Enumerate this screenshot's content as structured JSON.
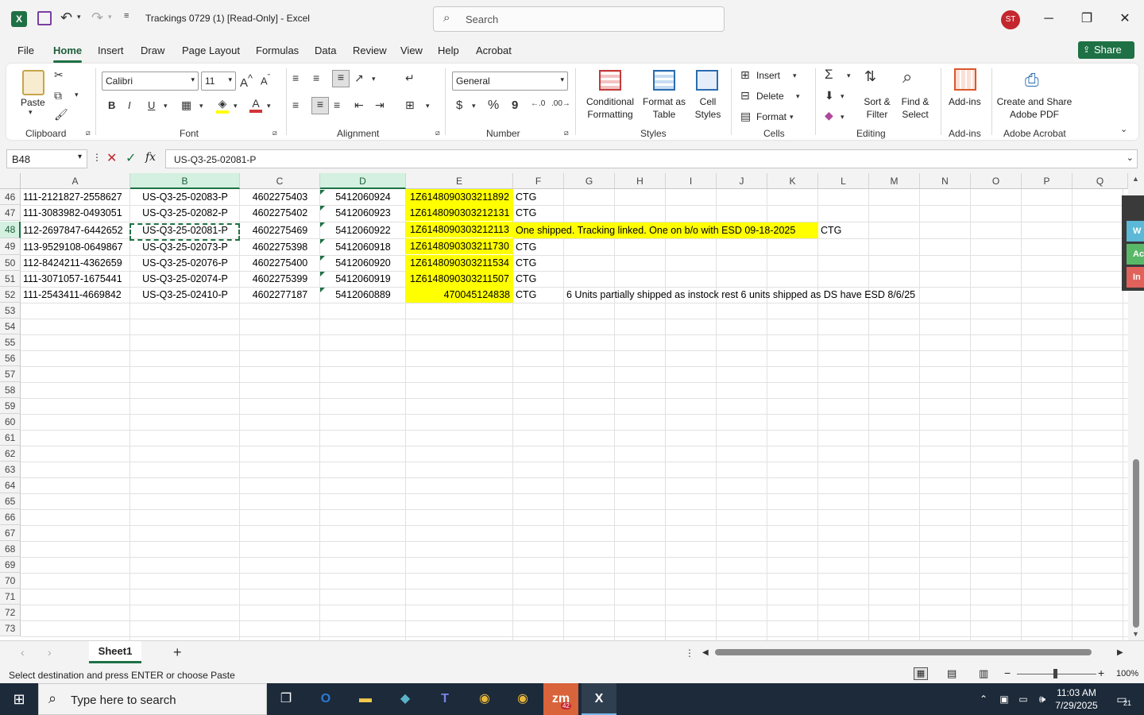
{
  "window": {
    "title": "Trackings 0729 (1)  [Read-Only]  -  Excel",
    "search_placeholder": "Search",
    "user_initials": "ST"
  },
  "menu": {
    "tabs": [
      "File",
      "Home",
      "Insert",
      "Draw",
      "Page Layout",
      "Formulas",
      "Data",
      "Review",
      "View",
      "Help",
      "Acrobat"
    ],
    "active": "Home",
    "share_label": "Share"
  },
  "ribbon": {
    "clipboard": {
      "paste": "Paste",
      "label": "Clipboard"
    },
    "font": {
      "name": "Calibri",
      "size": "11",
      "label": "Font",
      "bold": "B",
      "italic": "I",
      "underline": "U"
    },
    "alignment": {
      "label": "Alignment"
    },
    "number": {
      "format": "General",
      "currency": "$",
      "percent": "%",
      "comma": "9",
      "label": "Number"
    },
    "styles": {
      "conditional": [
        "Conditional",
        "Formatting"
      ],
      "format_table": [
        "Format as",
        "Table"
      ],
      "cell_styles": [
        "Cell",
        "Styles"
      ],
      "label": "Styles"
    },
    "cells": {
      "insert": "Insert",
      "delete": "Delete",
      "format": "Format",
      "label": "Cells"
    },
    "editing": {
      "sort": [
        "Sort &",
        "Filter"
      ],
      "find": [
        "Find &",
        "Select"
      ],
      "label": "Editing"
    },
    "addins": {
      "btn": "Add-ins",
      "label": "Add-ins"
    },
    "acrobat": {
      "btn": [
        "Create and Share",
        "Adobe PDF"
      ],
      "label": "Adobe Acrobat"
    }
  },
  "formula_bar": {
    "name_box": "B48",
    "fx": "fx",
    "value": "US-Q3-25-02081-P"
  },
  "columns": [
    "A",
    "B",
    "C",
    "D",
    "E",
    "F",
    "G",
    "H",
    "I",
    "J",
    "K",
    "L",
    "M",
    "N",
    "O",
    "P",
    "Q"
  ],
  "rows": [
    {
      "n": "46",
      "A": "111-2121827-2558627",
      "B": "US-Q3-25-02083-P",
      "C": "4602275403",
      "D": "5412060924",
      "E": "1Z6148090303211892",
      "F": "CTG"
    },
    {
      "n": "47",
      "A": "111-3083982-0493051",
      "B": "US-Q3-25-02082-P",
      "C": "4602275402",
      "D": "5412060923",
      "E": "1Z6148090303212131",
      "F": "CTG"
    },
    {
      "n": "48",
      "A": "112-2697847-6442652",
      "B": "US-Q3-25-02081-P",
      "C": "4602275469",
      "D": "5412060922",
      "E": "1Z6148090303212113",
      "F": "One shipped. Tracking linked. One on b/o with ESD 09-18-2025",
      "L": "CTG"
    },
    {
      "n": "49",
      "A": "113-9529108-0649867",
      "B": "US-Q3-25-02073-P",
      "C": "4602275398",
      "D": "5412060918",
      "E": "1Z6148090303211730",
      "F": "CTG"
    },
    {
      "n": "50",
      "A": "112-8424211-4362659",
      "B": "US-Q3-25-02076-P",
      "C": "4602275400",
      "D": "5412060920",
      "E": "1Z6148090303211534",
      "F": "CTG"
    },
    {
      "n": "51",
      "A": "111-3071057-1675441",
      "B": "US-Q3-25-02074-P",
      "C": "4602275399",
      "D": "5412060919",
      "E": "1Z6148090303211507",
      "F": "CTG"
    },
    {
      "n": "52",
      "A": "111-2543411-4669842",
      "B": "US-Q3-25-02410-P",
      "C": "4602277187",
      "D": "5412060889",
      "E": "470045124838",
      "F": "CTG",
      "G": "6 Units partially shipped as instock rest 6 units shipped as DS have ESD 8/6/25"
    }
  ],
  "empty_rows": [
    "53",
    "54",
    "55",
    "56",
    "57",
    "58",
    "59",
    "60",
    "61",
    "62",
    "63",
    "64",
    "65",
    "66",
    "67",
    "68",
    "69",
    "70",
    "71",
    "72",
    "73"
  ],
  "side_panel_tabs": [
    "W",
    "Ac",
    "In"
  ],
  "sheet": {
    "name": "Sheet1",
    "add": "+"
  },
  "status": {
    "message": "Select destination and press ENTER or choose Paste",
    "zoom": "100%"
  },
  "taskbar": {
    "search_placeholder": "Type here to search",
    "time": "11:03 AM",
    "date": "7/29/2025",
    "notifications": "21",
    "zoom_badge": "42"
  },
  "colors": {
    "excel_green": "#1e7145",
    "highlight": "#ffff00",
    "avatar": "#c4262e"
  }
}
